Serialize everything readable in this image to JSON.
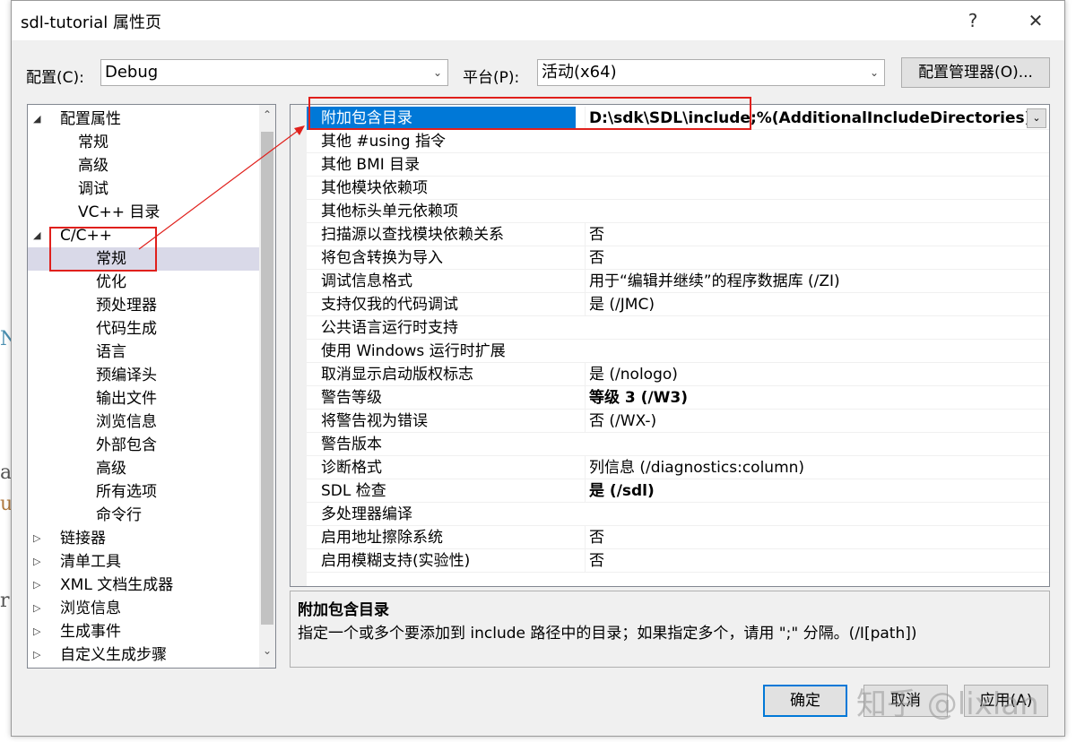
{
  "window": {
    "title": "sdl-tutorial 属性页",
    "help_glyph": "?",
    "close_glyph": "✕"
  },
  "toolbar": {
    "config_label": "配置(C):",
    "config_value": "Debug",
    "platform_label": "平台(P):",
    "platform_value": "活动(x64)",
    "config_manager_label": "配置管理器(O)..."
  },
  "tree": {
    "items": [
      {
        "label": "配置属性",
        "twisty": "◢"
      },
      {
        "label": "常规"
      },
      {
        "label": "高级"
      },
      {
        "label": "调试"
      },
      {
        "label": "VC++ 目录"
      },
      {
        "label": "C/C++",
        "twisty": "◢"
      },
      {
        "label": "常规"
      },
      {
        "label": "优化"
      },
      {
        "label": "预处理器"
      },
      {
        "label": "代码生成"
      },
      {
        "label": "语言"
      },
      {
        "label": "预编译头"
      },
      {
        "label": "输出文件"
      },
      {
        "label": "浏览信息"
      },
      {
        "label": "外部包含"
      },
      {
        "label": "高级"
      },
      {
        "label": "所有选项"
      },
      {
        "label": "命令行"
      },
      {
        "label": "链接器",
        "twisty": "▷"
      },
      {
        "label": "清单工具",
        "twisty": "▷"
      },
      {
        "label": "XML 文档生成器",
        "twisty": "▷"
      },
      {
        "label": "浏览信息",
        "twisty": "▷"
      },
      {
        "label": "生成事件",
        "twisty": "▷"
      },
      {
        "label": "自定义生成步骤",
        "twisty": "▷"
      }
    ]
  },
  "properties": [
    {
      "name": "附加包含目录",
      "value": "D:\\sdk\\SDL\\include;%(AdditionalIncludeDirectories)"
    },
    {
      "name": "其他 #using 指令",
      "value": ""
    },
    {
      "name": "其他 BMI 目录",
      "value": ""
    },
    {
      "name": "其他模块依赖项",
      "value": ""
    },
    {
      "name": "其他标头单元依赖项",
      "value": ""
    },
    {
      "name": "扫描源以查找模块依赖关系",
      "value": "否"
    },
    {
      "name": "将包含转换为导入",
      "value": "否"
    },
    {
      "name": "调试信息格式",
      "value": "用于“编辑并继续”的程序数据库 (/ZI)"
    },
    {
      "name": "支持仅我的代码调试",
      "value": "是 (/JMC)"
    },
    {
      "name": "公共语言运行时支持",
      "value": ""
    },
    {
      "name": "使用 Windows 运行时扩展",
      "value": ""
    },
    {
      "name": "取消显示启动版权标志",
      "value": "是 (/nologo)"
    },
    {
      "name": "警告等级",
      "value": "等级 3 (/W3)"
    },
    {
      "name": "将警告视为错误",
      "value": "否 (/WX-)"
    },
    {
      "name": "警告版本",
      "value": ""
    },
    {
      "name": "诊断格式",
      "value": "列信息 (/diagnostics:column)"
    },
    {
      "name": "SDL 检查",
      "value": "是 (/sdl)"
    },
    {
      "name": "多处理器编译",
      "value": ""
    },
    {
      "name": "启用地址擦除系统",
      "value": "否"
    },
    {
      "name": "启用模糊支持(实验性)",
      "value": "否"
    }
  ],
  "description": {
    "title": "附加包含目录",
    "text": "指定一个或多个要添加到 include 路径中的目录；如果指定多个，请用 \";\" 分隔。(/I[path])"
  },
  "buttons": {
    "ok": "确定",
    "cancel": "取消",
    "apply": "应用(A)"
  },
  "watermark": "知乎 @lixlan",
  "annotation_color": "#e0201c"
}
